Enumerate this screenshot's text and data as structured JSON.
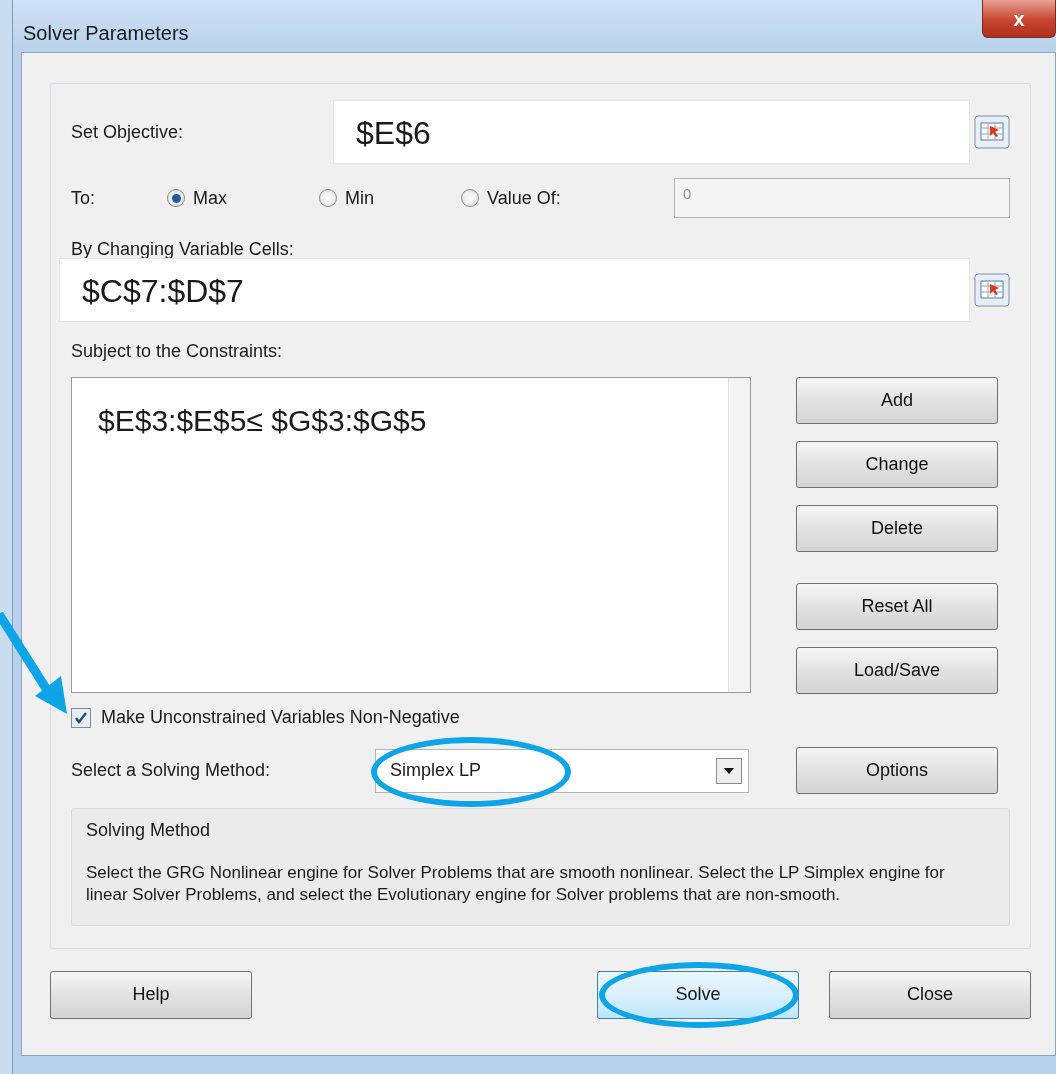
{
  "window": {
    "title": "Solver Parameters",
    "close": "x"
  },
  "objective": {
    "label": "Set Objective:",
    "value": "$E$6"
  },
  "to": {
    "label": "To:",
    "options": [
      {
        "label": "Max",
        "selected": true
      },
      {
        "label": "Min",
        "selected": false
      },
      {
        "label": "Value Of:",
        "selected": false
      }
    ],
    "value_of": "0"
  },
  "variables": {
    "label": "By Changing Variable Cells:",
    "value": "$C$7:$D$7"
  },
  "constraints": {
    "label": "Subject to the Constraints:",
    "items": [
      "$E$3:$E$5≤ $G$3:$G$5"
    ]
  },
  "side_buttons": [
    "Add",
    "Change",
    "Delete",
    "Reset All",
    "Load/Save"
  ],
  "non_negative": {
    "label": "Make Unconstrained Variables Non-Negative",
    "checked": true,
    "arrow": true
  },
  "method": {
    "label": "Select a Solving Method:",
    "value": "Simplex LP",
    "circled": true,
    "button": "Options"
  },
  "method_info": {
    "title": "Solving Method",
    "text": "Select the GRG Nonlinear engine for Solver Problems that are smooth nonlinear. Select the LP Simplex engine for linear Solver Problems, and select the Evolutionary engine for Solver problems that are non-smooth."
  },
  "bottom_buttons": [
    {
      "label": "Help",
      "circled": false
    },
    {
      "label": "Solve",
      "circled": true
    },
    {
      "label": "Close",
      "circled": false
    }
  ]
}
